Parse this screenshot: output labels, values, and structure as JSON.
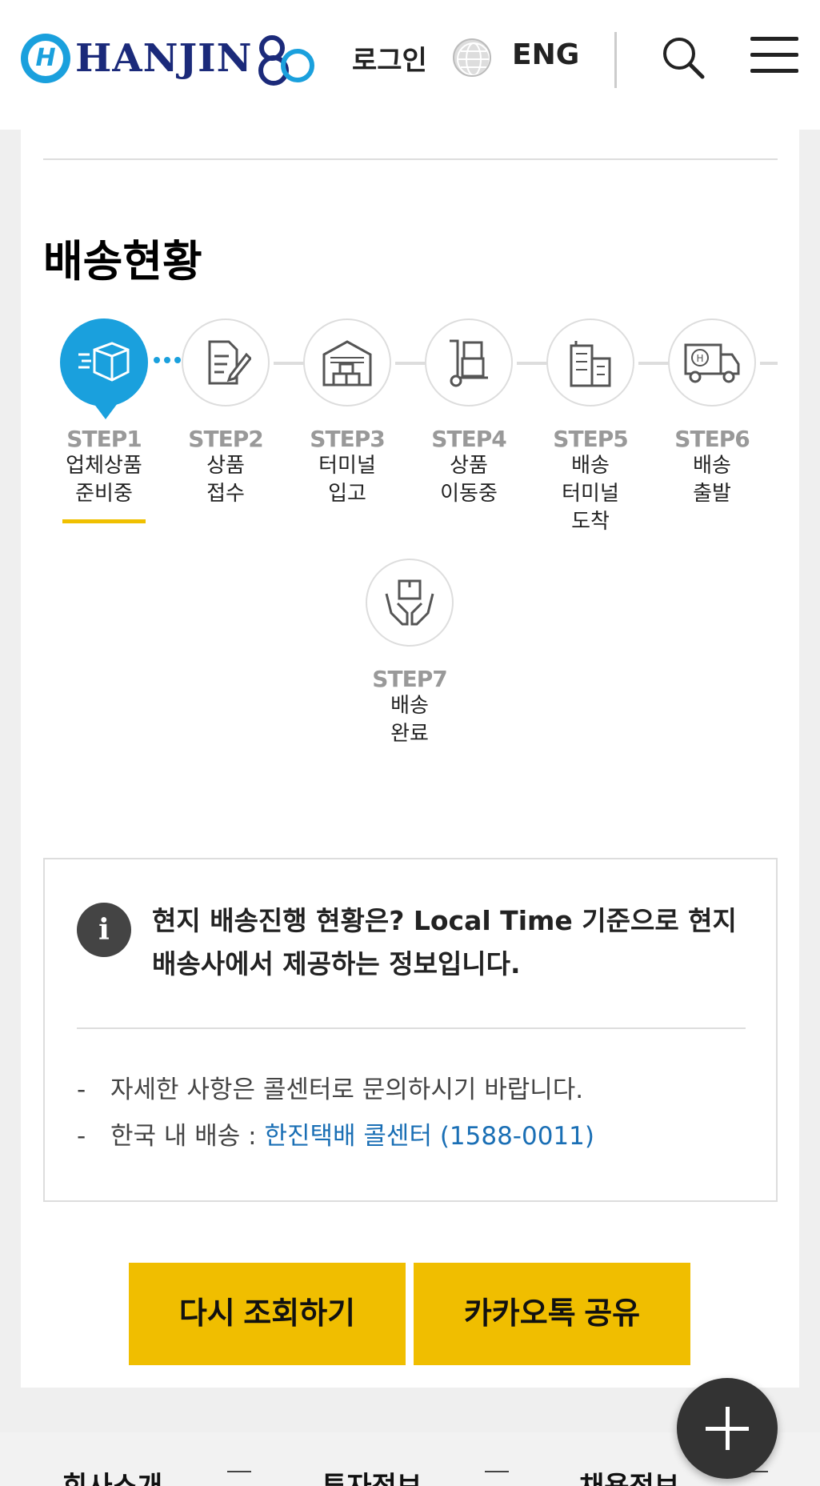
{
  "header": {
    "logo_text": "HANJIN",
    "login_label": "로그인",
    "lang_label": "ENG",
    "icons": [
      "hanjin-logo-icon",
      "globe-icon",
      "search-icon",
      "menu-icon"
    ]
  },
  "main": {
    "section_title": "배송현황",
    "steps": [
      {
        "label": "STEP1",
        "desc_line1": "업체상품",
        "desc_line2": "준비중",
        "desc_line3": "",
        "icon": "package-icon",
        "active": true
      },
      {
        "label": "STEP2",
        "desc_line1": "상품",
        "desc_line2": "접수",
        "desc_line3": "",
        "icon": "document-pen-icon",
        "active": false
      },
      {
        "label": "STEP3",
        "desc_line1": "터미널",
        "desc_line2": "입고",
        "desc_line3": "",
        "icon": "warehouse-icon",
        "active": false
      },
      {
        "label": "STEP4",
        "desc_line1": "상품",
        "desc_line2": "이동중",
        "desc_line3": "",
        "icon": "hand-truck-icon",
        "active": false
      },
      {
        "label": "STEP5",
        "desc_line1": "배송",
        "desc_line2": "터미널",
        "desc_line3": "도착",
        "icon": "building-icon",
        "active": false
      },
      {
        "label": "STEP6",
        "desc_line1": "배송",
        "desc_line2": "출발",
        "desc_line3": "",
        "icon": "delivery-truck-icon",
        "active": false
      },
      {
        "label": "STEP7",
        "desc_line1": "배송",
        "desc_line2": "완료",
        "desc_line3": "",
        "icon": "hands-package-icon",
        "active": false
      }
    ],
    "info": {
      "icon_glyph": "i",
      "title": "현지 배송진행 현황은? Local Time 기준으로 현지 배송사에서 제공하는 정보입니다.",
      "line1_dash": "-",
      "line1": "자세한 사항은 콜센터로 문의하시기 바랍니다.",
      "line2_dash": "-",
      "line2_prefix": "한국 내 배송 : ",
      "line2_link": "한진택배 콜센터 (1588-0011)"
    },
    "buttons": {
      "retry_label": "다시 조회하기",
      "kakao_label": "카카오톡 공유"
    }
  },
  "footer": {
    "items": [
      "회사소개",
      "투자정보",
      "채용정보"
    ]
  },
  "colors": {
    "brand_blue": "#1aa0dd",
    "brand_navy": "#1b2a7a",
    "button_yellow": "#f0be00",
    "link_blue": "#1a6fb5"
  }
}
